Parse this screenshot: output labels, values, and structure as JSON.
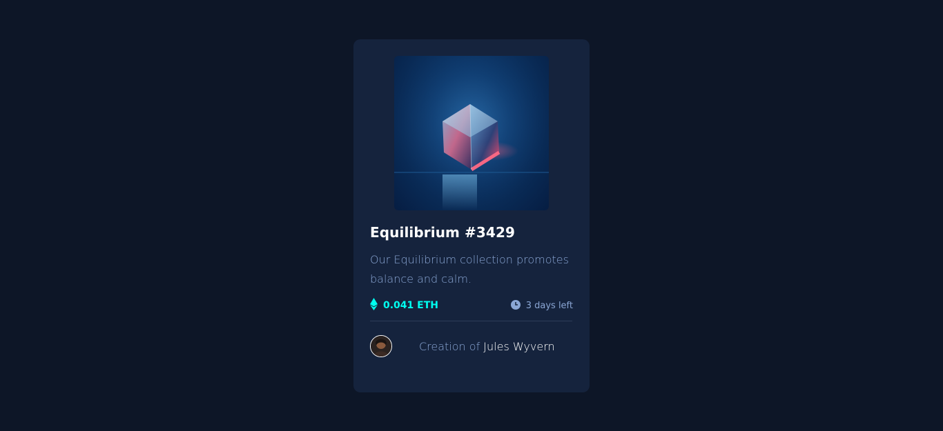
{
  "card": {
    "image_alt": "Equilibrium crystal cube",
    "title": "Equilibrium #3429",
    "description": "Our Equilibrium collection promotes balance and calm.",
    "price": "0.041 ETH",
    "time_left": "3 days left",
    "creator_prefix": "Creation of",
    "creator_name": "Jules Wyvern",
    "icons": {
      "price": "ethereum-icon",
      "time": "clock-icon",
      "creator": "avatar"
    }
  },
  "colors": {
    "page_bg": "#0d1627",
    "card_bg": "#15233d",
    "accent_cyan": "#00fff0",
    "soft_blue": "#8aa6d4",
    "white": "#ffffff",
    "divider": "#2e3d59"
  }
}
